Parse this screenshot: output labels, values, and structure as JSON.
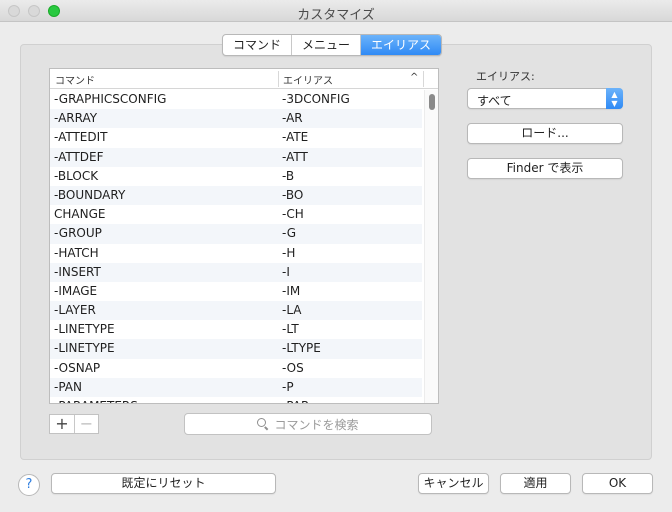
{
  "window": {
    "title": "カスタマイズ"
  },
  "tabs": [
    {
      "label": "コマンド",
      "active": false
    },
    {
      "label": "メニュー",
      "active": false
    },
    {
      "label": "エイリアス",
      "active": true
    }
  ],
  "table": {
    "col_command": "コマンド",
    "col_alias": "エイリアス",
    "sort_icon": "chevron-up-icon",
    "rows": [
      {
        "command": "-GRAPHICSCONFIG",
        "alias": "-3DCONFIG"
      },
      {
        "command": "-ARRAY",
        "alias": "-AR"
      },
      {
        "command": "-ATTEDIT",
        "alias": "-ATE"
      },
      {
        "command": "-ATTDEF",
        "alias": "-ATT"
      },
      {
        "command": "-BLOCK",
        "alias": "-B"
      },
      {
        "command": "-BOUNDARY",
        "alias": "-BO"
      },
      {
        "command": "CHANGE",
        "alias": "-CH"
      },
      {
        "command": "-GROUP",
        "alias": "-G"
      },
      {
        "command": "-HATCH",
        "alias": "-H"
      },
      {
        "command": "-INSERT",
        "alias": "-I"
      },
      {
        "command": "-IMAGE",
        "alias": "-IM"
      },
      {
        "command": "-LAYER",
        "alias": "-LA"
      },
      {
        "command": "-LINETYPE",
        "alias": "-LT"
      },
      {
        "command": "-LINETYPE",
        "alias": "-LTYPE"
      },
      {
        "command": "-OSNAP",
        "alias": "-OS"
      },
      {
        "command": "-PAN",
        "alias": "-P"
      },
      {
        "command": "-PARAMETERS",
        "alias": "-PAR"
      }
    ]
  },
  "controls": {
    "add": "+",
    "remove": "−",
    "search_placeholder": "コマンドを検索"
  },
  "sidebar": {
    "alias_label": "エイリアス:",
    "alias_filter_value": "すべて",
    "load_button": "ロード...",
    "finder_button": "Finder で表示"
  },
  "footer": {
    "help": "?",
    "reset": "既定にリセット",
    "cancel": "キャンセル",
    "apply": "適用",
    "ok": "OK"
  },
  "colors": {
    "accent": "#2f8af5",
    "zoom": "#29c940"
  }
}
